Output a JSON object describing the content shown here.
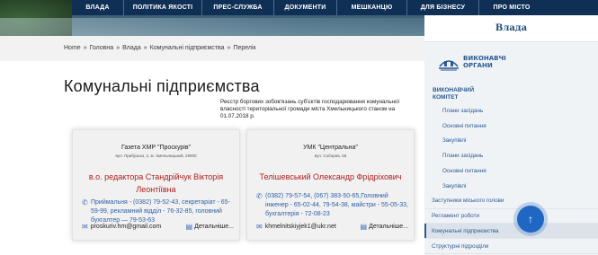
{
  "nav": {
    "items": [
      "ВЛАДА",
      "ПОЛІТИКА ЯКОСТІ",
      "ПРЕС-СЛУЖБА",
      "ДОКУМЕНТИ",
      "МЕШКАНЦЮ",
      "ДЛЯ БІЗНЕСУ",
      "ПРО МІСТО"
    ]
  },
  "breadcrumb": [
    "Home",
    "Головна",
    "Влада",
    "Комунальні підприємства",
    "Перелік"
  ],
  "breadcrumb_sep": "»",
  "page": {
    "title": "Комунальні підприємства",
    "intro": "Реєстр боргових зобов'язань суб'єктів господарювання комунальної власності територіальної громади міста Хмельницького станом на 01.07.2018 р."
  },
  "cards": [
    {
      "name": "Газета ХМР \"Проскурів\"",
      "address": "вул. Прибузька, 2, м. Хмельницький, 29000",
      "head": "в.о. редактора Стандрійчук Вікторія Леонтіївна",
      "phones": "Приймальня - (0382) 79-52-43, секретаріат - 65-59-99, рекламний відділ - 76-32-85, головний бухгалтер — 79-53-63",
      "email": "proskuriv.hm@gmail.com",
      "details": "Детальніше..."
    },
    {
      "name": "УМК \"Центральна\"",
      "address": "вул. Соборна, 56",
      "head": "Телішевський Олександр Фрідріхович",
      "phones": "(0382) 79-57-54, (067) 383-50-65,Головний інженер - 65-02-44, 79-54-38, майстри - 55-05-33, бухгалтерія - 72-08-23",
      "email": "khmelnitskiyjek1@ukr.net",
      "details": "Детальніше..."
    }
  ],
  "sidebar": {
    "header": "Влада",
    "logo_label": "ВИКОНАВЧІ ОРГАНИ",
    "section": "ВИКОНАВЧИЙ КОМІТЕТ",
    "items": [
      {
        "label": "Плани засідань",
        "level": "sub"
      },
      {
        "label": "Основні питання",
        "level": "sub"
      },
      {
        "label": "Закупівлі",
        "level": "sub"
      },
      {
        "label": "Плани засідань",
        "level": "sub"
      },
      {
        "label": "Основні питання",
        "level": "sub"
      },
      {
        "label": "Закупівлі",
        "level": "sub"
      },
      {
        "label": "Заступники міського голови",
        "level": "top"
      },
      {
        "label": "Регламент роботи",
        "level": "top"
      },
      {
        "label": "Комунальні підприємства",
        "level": "top",
        "active": true
      },
      {
        "label": "Структурні підрозділи",
        "level": "top"
      }
    ]
  },
  "colors": {
    "nav_bg": "#0f2f55",
    "accent": "#2b5a92",
    "head_red": "#b01d1d",
    "scroll_button": "#1f67c2"
  },
  "icons": {
    "phone": "phone-icon",
    "mail": "mail-icon",
    "details": "document-icon",
    "scroll": "arrow-up-icon",
    "logo": "city-emblem-icon"
  }
}
